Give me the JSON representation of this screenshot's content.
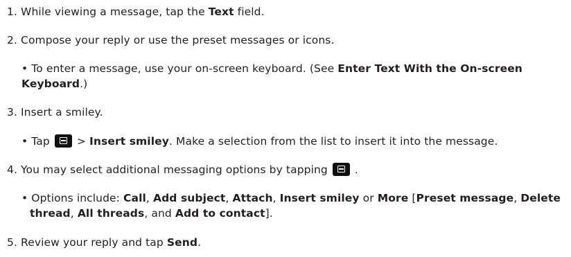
{
  "steps": {
    "s1": {
      "num": "1. ",
      "pre": "While viewing a message, tap the ",
      "bold": "Text",
      "post": " field."
    },
    "s2": {
      "num": "2. ",
      "text": "Compose your reply or use the preset messages or icons.",
      "bullet": {
        "marker": "• ",
        "pre": "To enter a message, use your on-screen keyboard. (See ",
        "bold_line1": "Enter Text With the On-screen",
        "bold_line2": "Keyboard",
        "post": ".)"
      }
    },
    "s3": {
      "num": "3. ",
      "text": "Insert a smiley.",
      "bullet": {
        "marker": "• ",
        "pre": "Tap ",
        "icon": "menu-key-icon",
        "sep": " > ",
        "bold": "Insert smiley",
        "post": ". Make a selection from the list to insert it into the message."
      }
    },
    "s4": {
      "num": "4. ",
      "pre": "You may select additional messaging options by tapping ",
      "icon": "menu-key-icon",
      "post": " .",
      "bullet": {
        "marker": "• ",
        "pre": "Options include: ",
        "o1": "Call",
        "c1": ", ",
        "o2": "Add subject",
        "c2": ", ",
        "o3": "Attach",
        "c3": ", ",
        "o4": "Insert smiley",
        "c4": " or ",
        "o5": "More",
        "c5": " [",
        "o6": "Preset message",
        "c6": ", ",
        "o7a": "Delete",
        "o7b": "thread",
        "c7": ", ",
        "o8": "All threads",
        "c8": ", and ",
        "o9": "Add to contact",
        "c9": "]."
      }
    },
    "s5": {
      "num": "5. ",
      "pre": "Review your reply and tap ",
      "bold": "Send",
      "post": "."
    }
  },
  "colors": {
    "text": "#231f20",
    "icon_bg": "#101010"
  }
}
